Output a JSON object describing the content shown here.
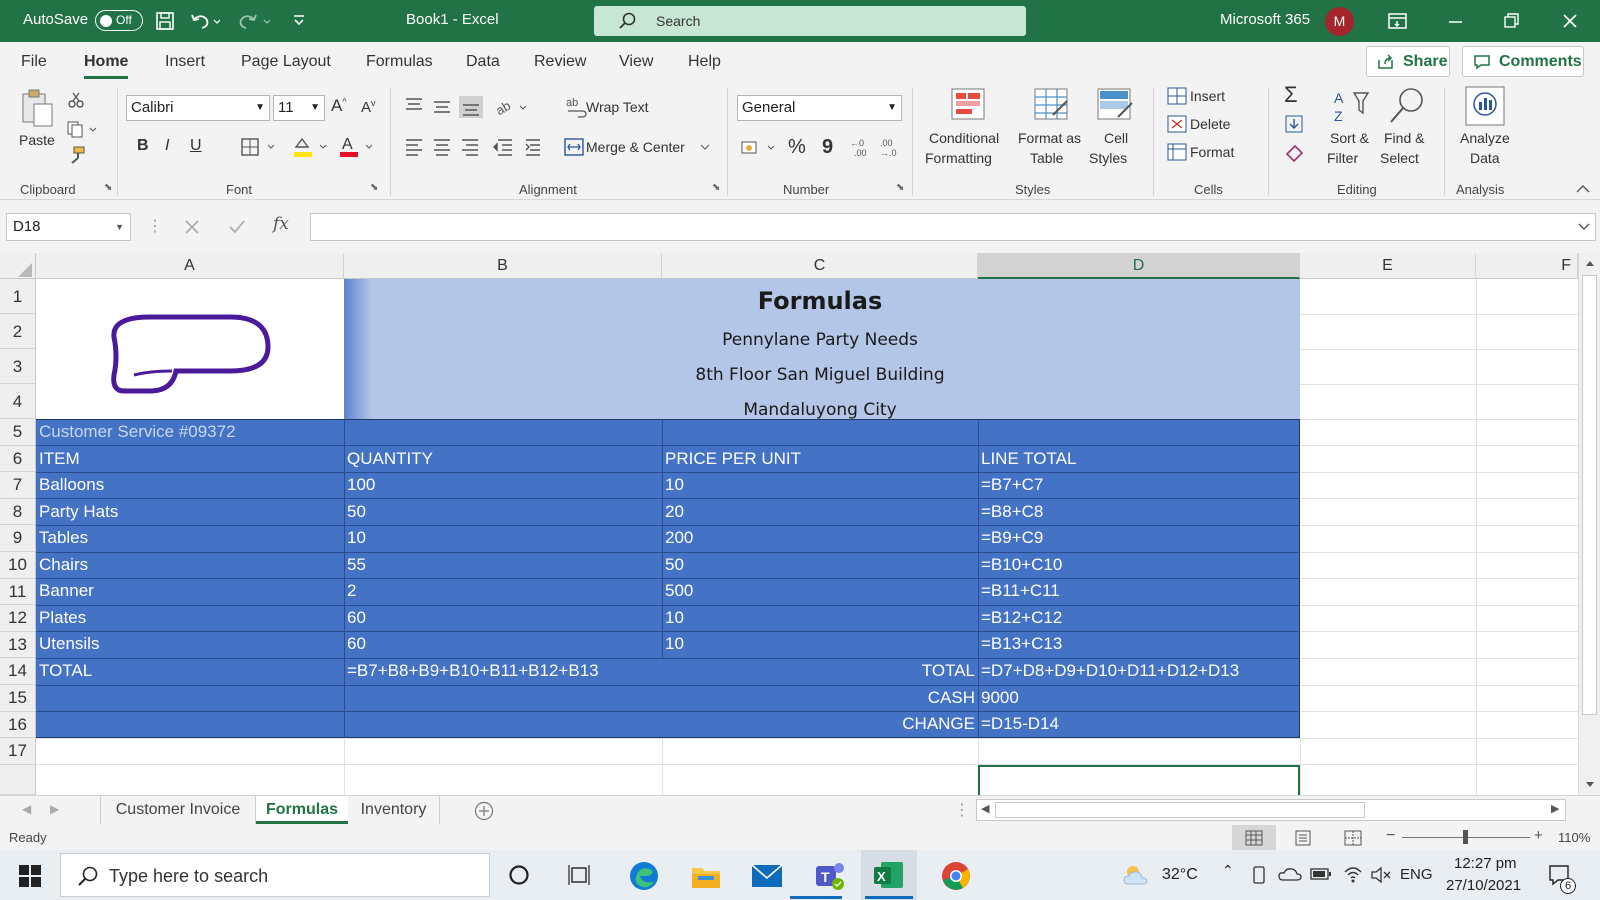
{
  "titlebar": {
    "autosave_label": "AutoSave",
    "autosave_state": "Off",
    "doc_title": "Book1  -  Excel",
    "search_placeholder": "Search",
    "account_label": "Microsoft 365",
    "avatar_initial": "M"
  },
  "menu": {
    "tabs": [
      "File",
      "Home",
      "Insert",
      "Page Layout",
      "Formulas",
      "Data",
      "Review",
      "View",
      "Help"
    ],
    "active": "Home",
    "share_label": "Share",
    "comments_label": "Comments"
  },
  "ribbon": {
    "clipboard": {
      "paste": "Paste",
      "group": "Clipboard"
    },
    "font": {
      "font_name": "Calibri",
      "font_size": "11",
      "group": "Font",
      "bold": "B",
      "italic": "I",
      "underline": "U"
    },
    "alignment": {
      "wrap_text": "Wrap Text",
      "merge_center": "Merge & Center",
      "group": "Alignment"
    },
    "number": {
      "format": "General",
      "group": "Number",
      "percent": "%",
      "comma": "9"
    },
    "styles": {
      "conditional": "Conditional",
      "conditional2": "Formatting",
      "format_as": "Format as",
      "format_as2": "Table",
      "cell": "Cell",
      "cell2": "Styles",
      "group": "Styles"
    },
    "cells": {
      "insert": "Insert",
      "delete": "Delete",
      "format": "Format",
      "group": "Cells"
    },
    "editing": {
      "sort": "Sort &",
      "sort2": "Filter",
      "find": "Find &",
      "find2": "Select",
      "group": "Editing"
    },
    "analysis": {
      "analyze": "Analyze",
      "analyze2": "Data",
      "group": "Analysis"
    }
  },
  "formula_bar": {
    "name_box": "D18",
    "fx": "fx",
    "content": ""
  },
  "grid": {
    "columns": [
      "A",
      "B",
      "C",
      "D",
      "E",
      "F"
    ],
    "selected_column": "D",
    "rows": [
      "1",
      "2",
      "3",
      "4",
      "5",
      "6",
      "7",
      "8",
      "9",
      "10",
      "11",
      "12",
      "13",
      "14",
      "15",
      "16",
      "17"
    ],
    "header_title": "Formulas",
    "company": "Pennylane Party Needs",
    "address1": "8th Floor San Miguel Building",
    "address2": "Mandaluyong City",
    "customer_service": "Customer Service #09372",
    "col_headers": [
      "ITEM",
      "QUANTITY",
      "PRICE PER UNIT",
      "LINE TOTAL"
    ],
    "items": [
      [
        "Balloons",
        "100",
        "10",
        "=B7+C7"
      ],
      [
        "Party Hats",
        "50",
        "20",
        "=B8+C8"
      ],
      [
        "Tables",
        "10",
        "200",
        "=B9+C9"
      ],
      [
        "Chairs",
        "55",
        "50",
        "=B10+C10"
      ],
      [
        "Banner",
        "2",
        "500",
        "=B11+C11"
      ],
      [
        "Plates",
        "60",
        "10",
        "=B12+C12"
      ],
      [
        "Utensils",
        "60",
        "10",
        "=B13+C13"
      ]
    ],
    "total_row": {
      "label": "TOTAL",
      "qty_formula": "=B7+B8+B9+B10+B11+B12+B13",
      "total_label": "TOTAL",
      "total_formula": "=D7+D8+D9+D10+D11+D12+D13"
    },
    "cash_row": {
      "label": "CASH",
      "value": "9000"
    },
    "change_row": {
      "label": "CHANGE",
      "value": "=D15-D14"
    },
    "colors": {
      "header_band": "#b4c6e7",
      "table_fill": "#4472c4",
      "logo": "#4b1a9a"
    }
  },
  "sheets": {
    "tabs": [
      "Customer Invoice",
      "Formulas",
      "Inventory"
    ],
    "active": "Formulas"
  },
  "status": {
    "ready": "Ready",
    "zoom": "110%"
  },
  "taskbar": {
    "search_placeholder": "Type here to search",
    "temp": "32°C",
    "lang": "ENG",
    "time": "12:27 pm",
    "date": "27/10/2021",
    "notif_count": "6"
  }
}
